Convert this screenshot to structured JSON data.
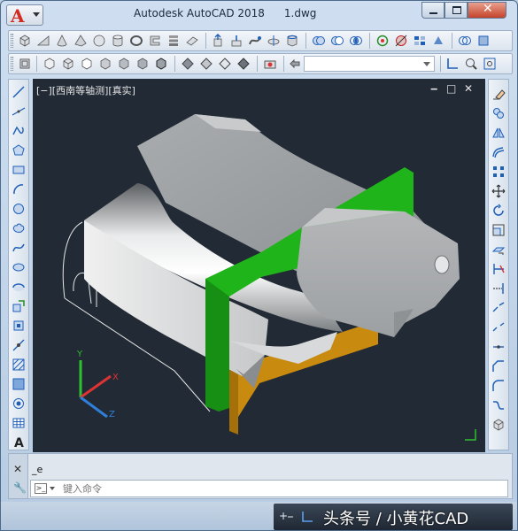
{
  "window": {
    "app_name": "Autodesk AutoCAD 2018",
    "document": "1.dwg",
    "app_menu_letter": "A"
  },
  "viewport": {
    "label": "[−][西南等轴测][真实]",
    "controls": [
      "‒",
      "□",
      "✕"
    ],
    "ucs_axes": [
      "Y",
      "X",
      "Z"
    ]
  },
  "command": {
    "history": "_e",
    "placeholder": "键入命令"
  },
  "status": {
    "watermark": "头条号 / 小黄花CAD"
  },
  "colors": {
    "viewport_bg": "#222a35",
    "green_plate": "#1fb41a",
    "orange_plate": "#c88a0f",
    "gray_body": "#b9bcbf"
  },
  "icons": {
    "toolbar1": [
      "box-icon",
      "wedge-icon",
      "cone-icon",
      "sphere-icon",
      "cylinder-icon",
      "torus-icon",
      "pyramid-icon",
      "extrude-icon",
      "revolve-icon",
      "sweep-icon",
      "loft-icon",
      "union-icon",
      "subtract-icon",
      "intersect-icon",
      "view-icon"
    ],
    "toolbar2": [
      "visual-style-icon",
      "shade-icon",
      "render-icon",
      "material-icon",
      "light-icon",
      "camera-icon",
      "layer-icon",
      "orbit-icon",
      "zoom-icon",
      "pan-icon"
    ],
    "left_palette": [
      "line-icon",
      "construction-line-icon",
      "polyline-icon",
      "polygon-icon",
      "rectangle-icon",
      "arc-icon",
      "circle-icon",
      "revcloud-icon",
      "spline-icon",
      "ellipse-icon",
      "ellipse-arc-icon",
      "insert-block-icon",
      "make-block-icon",
      "point-icon",
      "hatch-icon",
      "gradient-icon",
      "region-icon",
      "table-icon",
      "text-icon"
    ],
    "right_palette": [
      "erase-icon",
      "copy-icon",
      "mirror-icon",
      "offset-icon",
      "array-icon",
      "move-icon",
      "rotate-icon",
      "scale-icon",
      "stretch-icon",
      "trim-icon",
      "extend-icon",
      "break-point-icon",
      "break-icon",
      "join-icon",
      "chamfer-icon",
      "fillet-icon",
      "blend-icon",
      "explode-icon"
    ]
  }
}
